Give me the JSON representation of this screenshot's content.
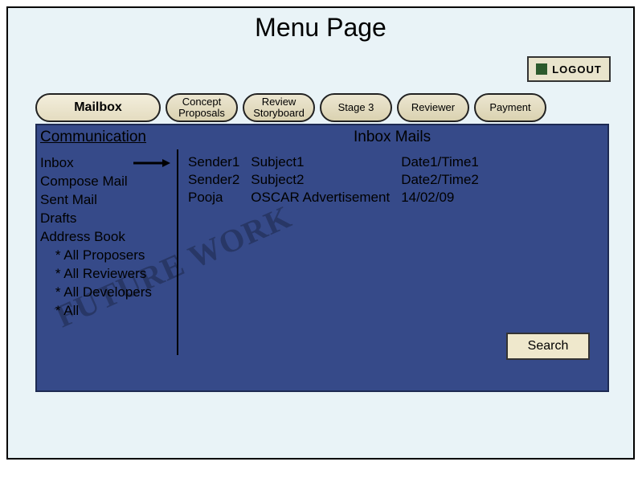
{
  "title": "Menu Page",
  "logout": "LOGOUT",
  "tabs": {
    "main": "Mailbox",
    "t1": "Concept\nProposals",
    "t2": "Review\nStoryboard",
    "t3": "Stage 3",
    "t4": "Reviewer",
    "t5": "Payment"
  },
  "section": "Communication",
  "inboxHeader": "Inbox Mails",
  "sidebar": {
    "inbox": "Inbox",
    "compose": "Compose Mail",
    "sent": "Sent Mail",
    "drafts": "Drafts",
    "abook": "Address Book",
    "s1": "    * All Proposers",
    "s2": "    * All Reviewers",
    "s3": "    * All Developers",
    "s4": "    * All"
  },
  "mails": [
    {
      "sender": "Sender1",
      "subject": "Subject1",
      "date": "Date1/Time1"
    },
    {
      "sender": "Sender2",
      "subject": "Subject2",
      "date": "Date2/Time2"
    },
    {
      "sender": "Pooja",
      "subject": "OSCAR Advertisement",
      "date": "14/02/09"
    }
  ],
  "search": "Search",
  "watermark": "FUTURE WORK"
}
